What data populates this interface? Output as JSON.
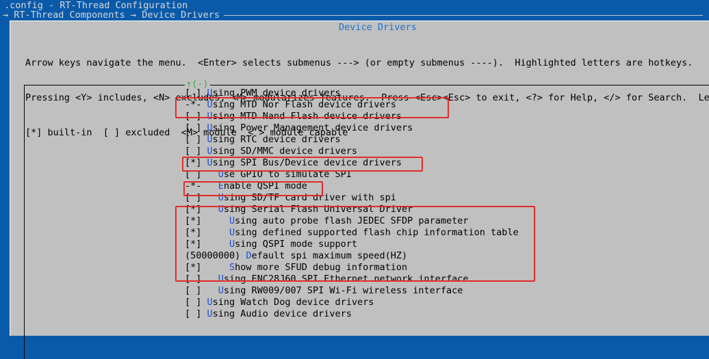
{
  "window": {
    "title": ".config - RT-Thread Configuration"
  },
  "breadcrumb": "→ RT-Thread Components → Device Drivers",
  "panel": {
    "title": "Device Drivers"
  },
  "help": {
    "line1": "Arrow keys navigate the menu.  <Enter> selects submenus ---> (or empty submenus ----).  Highlighted letters are hotkeys.",
    "line2": "Pressing <Y> includes, <N> excludes, <M> modularizes features.  Press <Esc><Esc> to exit, <?> for Help, </> for Search.  Lege",
    "line3": "[*] built-in  [ ] excluded  <M> module  < > module capable"
  },
  "scroll_indicator": "↑(-)",
  "menu": {
    "items": [
      {
        "prefix": "[ ] ",
        "hotkey": "U",
        "rest": "sing PWM device drivers"
      },
      {
        "prefix": "-*- ",
        "hotkey": "U",
        "rest": "sing MTD Nor Flash device drivers"
      },
      {
        "prefix": "[ ] ",
        "hotkey": "U",
        "rest": "sing MTD Nand Flash device drivers"
      },
      {
        "prefix": "[ ] ",
        "hotkey": "U",
        "rest": "sing Power Management device drivers"
      },
      {
        "prefix": "[ ] ",
        "hotkey": "U",
        "rest": "sing RTC device drivers"
      },
      {
        "prefix": "[ ] ",
        "hotkey": "U",
        "rest": "sing SD/MMC device drivers"
      },
      {
        "prefix": "[*] ",
        "hotkey": "U",
        "rest": "sing SPI Bus/Device device drivers"
      },
      {
        "prefix": "[ ]   ",
        "hotkey": "U",
        "rest": "se GPIO to simulate SPI"
      },
      {
        "prefix": "-*-   ",
        "hotkey": "E",
        "rest": "nable QSPI mode"
      },
      {
        "prefix": "[ ]   ",
        "hotkey": "U",
        "rest": "sing SD/TF card driver with spi"
      },
      {
        "prefix": "[*]   ",
        "hotkey": "U",
        "rest": "sing Serial Flash Universal Driver"
      },
      {
        "prefix": "[*]     ",
        "hotkey": "U",
        "rest": "sing auto probe flash JEDEC SFDP parameter"
      },
      {
        "prefix": "[*]     ",
        "hotkey": "U",
        "rest": "sing defined supported flash chip information table"
      },
      {
        "prefix": "[*]     ",
        "hotkey": "U",
        "rest": "sing QSPI mode support"
      },
      {
        "prefix": "(50000000) ",
        "hotkey": "D",
        "rest": "efault spi maximum speed(HZ)"
      },
      {
        "prefix": "[*]     ",
        "hotkey": "S",
        "rest": "how more SFUD debug information"
      },
      {
        "prefix": "[ ]   ",
        "hotkey": "U",
        "rest": "sing ENC28J60 SPI Ethernet network interface"
      },
      {
        "prefix": "[ ]   ",
        "hotkey": "U",
        "rest": "sing RW009/007 SPI Wi-Fi wireless interface"
      },
      {
        "prefix": "[ ] ",
        "hotkey": "U",
        "rest": "sing Watch Dog device drivers"
      },
      {
        "prefix": "[ ] ",
        "hotkey": "U",
        "rest": "sing Audio device drivers"
      }
    ]
  },
  "annotations": {
    "highlight_color": "#e12a2a",
    "hotkey_color": "#1c4cd8"
  }
}
